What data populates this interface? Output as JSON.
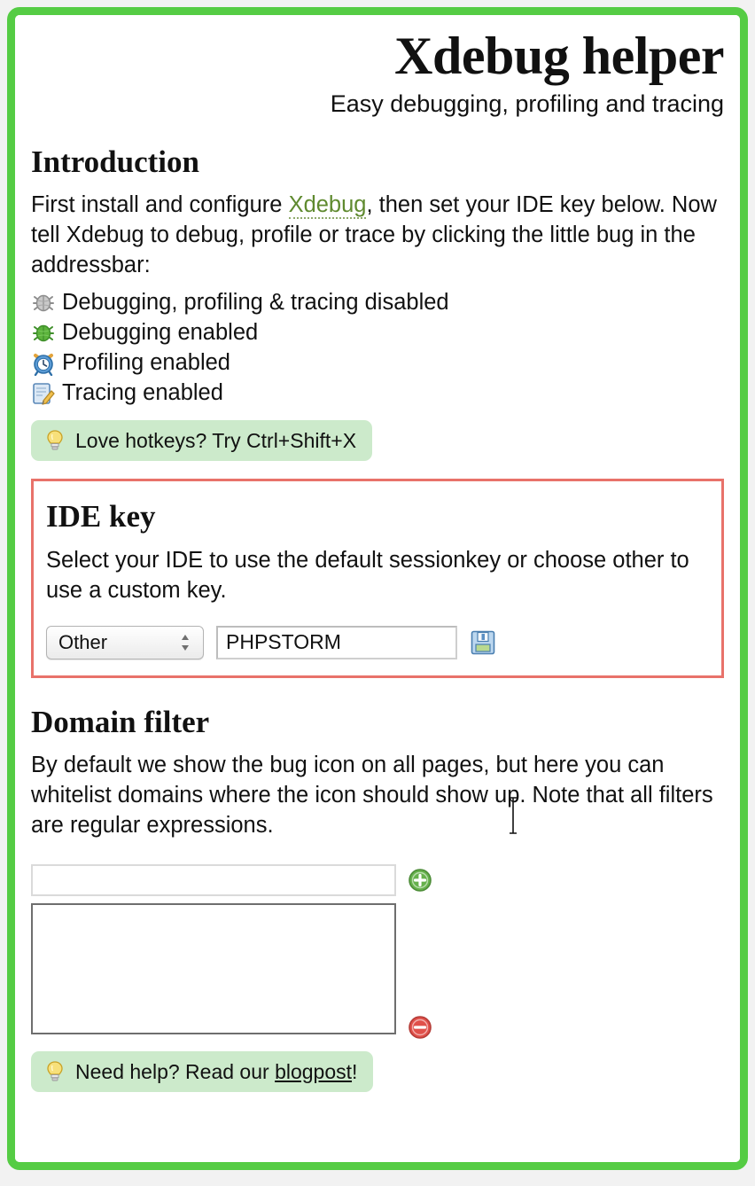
{
  "header": {
    "title": "Xdebug helper",
    "subtitle": "Easy debugging, profiling and tracing"
  },
  "introduction": {
    "heading": "Introduction",
    "paragraph_part1": "First install and configure ",
    "link_text": "Xdebug",
    "paragraph_part2": ", then set your IDE key below. Now tell Xdebug to debug, profile or trace by clicking the little bug in the addressbar:",
    "status_items": [
      {
        "icon": "bug-gray-icon",
        "label": "Debugging, profiling & tracing disabled"
      },
      {
        "icon": "bug-green-icon",
        "label": "Debugging enabled"
      },
      {
        "icon": "clock-icon",
        "label": "Profiling enabled"
      },
      {
        "icon": "notepad-pencil-icon",
        "label": "Tracing enabled"
      }
    ],
    "tip": {
      "icon": "lightbulb-icon",
      "text": "Love hotkeys? Try Ctrl+Shift+X"
    }
  },
  "ide_key": {
    "heading": "IDE key",
    "description": "Select your IDE to use the default sessionkey or choose other to use a custom key.",
    "select": {
      "value": "Other",
      "options": [
        "Other"
      ]
    },
    "custom_key": {
      "value": "PHPSTORM",
      "placeholder": ""
    },
    "save_icon": "floppy-disk-save-icon"
  },
  "domain_filter": {
    "heading": "Domain filter",
    "description": "By default we show the bug icon on all pages, but here you can whitelist domains where the icon should show up. Note that all filters are regular expressions.",
    "input": {
      "value": "",
      "placeholder": ""
    },
    "list_items": [],
    "add_icon": "plus-circle-icon",
    "remove_icon": "minus-circle-icon"
  },
  "footer": {
    "tip": {
      "icon": "lightbulb-icon",
      "text_before": "Need help? Read our ",
      "link_text": "blogpost",
      "text_after": "!"
    }
  },
  "colors": {
    "panel_border": "#55cc44",
    "ide_box_border": "#e8726a",
    "tip_background": "#cceacb",
    "link_green": "#5f8a2f",
    "add_green": "#66b14c",
    "remove_red": "#e0504a"
  }
}
